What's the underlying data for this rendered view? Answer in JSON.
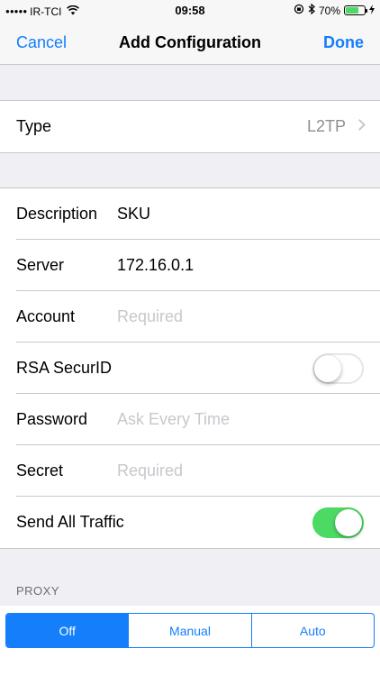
{
  "status_bar": {
    "carrier": "IR-TCI",
    "time": "09:58",
    "battery": "70%",
    "battery_level": 0.7
  },
  "nav": {
    "cancel": "Cancel",
    "title": "Add Configuration",
    "done": "Done"
  },
  "type_row": {
    "label": "Type",
    "value": "L2TP"
  },
  "fields": {
    "description": {
      "label": "Description",
      "value": "SKU"
    },
    "server": {
      "label": "Server",
      "value": "172.16.0.1"
    },
    "account": {
      "label": "Account",
      "placeholder": "Required"
    },
    "rsa": {
      "label": "RSA SecurID",
      "on": false
    },
    "password": {
      "label": "Password",
      "placeholder": "Ask Every Time"
    },
    "secret": {
      "label": "Secret",
      "placeholder": "Required"
    },
    "send_all": {
      "label": "Send All Traffic",
      "on": true
    }
  },
  "proxy": {
    "header": "PROXY",
    "options": [
      "Off",
      "Manual",
      "Auto"
    ],
    "selected": "Off"
  },
  "colors": {
    "accent": "#147efb",
    "toggle_on": "#4cd964",
    "background": "#efeff4"
  }
}
